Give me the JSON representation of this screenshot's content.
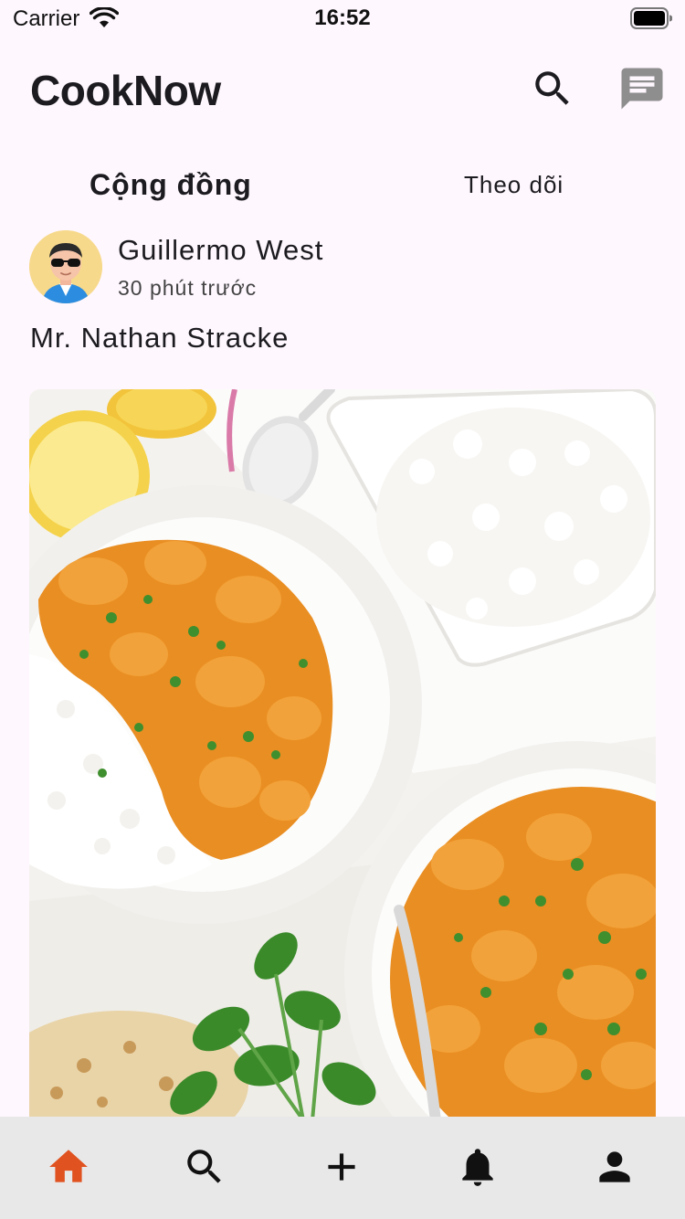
{
  "status_bar": {
    "carrier": "Carrier",
    "time": "16:52"
  },
  "app_bar": {
    "title": "CookNow",
    "icons": [
      "search-icon",
      "chat-icon"
    ]
  },
  "tabs": [
    {
      "label": "Cộng đồng",
      "selected": true
    },
    {
      "label": "Theo dõi",
      "selected": false
    }
  ],
  "post": {
    "author": "Guillermo West",
    "time": "30 phút trước",
    "title": "Mr. Nathan Stracke"
  },
  "bottom_nav": {
    "items": [
      "home-icon",
      "search-icon",
      "add-icon",
      "bell-icon",
      "profile-icon"
    ],
    "active": "home-icon",
    "active_color": "#E0521F",
    "icon_color": "#111111"
  }
}
